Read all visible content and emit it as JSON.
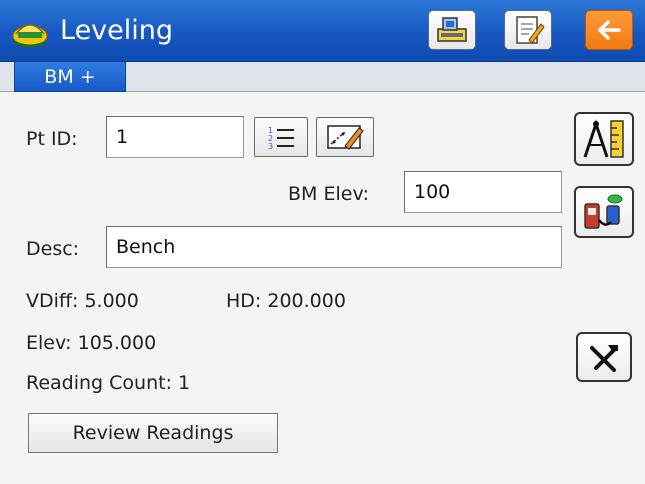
{
  "app": {
    "title": "Leveling"
  },
  "titlebar": {
    "icons": [
      "leveling-app-icon",
      "survey-instrument-icon",
      "notes-icon",
      "back-arrow-icon"
    ]
  },
  "tabs": [
    {
      "label": "BM +"
    }
  ],
  "form": {
    "pt_id_label": "Pt ID:",
    "pt_id_value": "1",
    "bm_elev_label": "BM Elev:",
    "bm_elev_value": "100",
    "desc_label": "Desc:",
    "desc_value": "Bench"
  },
  "results": {
    "vdiff": "VDiff: 5.000",
    "hd": "HD:  200.000",
    "elev": "Elev: 105.000",
    "reading_count": "Reading Count: 1"
  },
  "buttons": {
    "review_readings": "Review Readings"
  },
  "colors": {
    "titlebar": "#1757c2",
    "tab": "#1659c8",
    "back_button": "#f27a10",
    "panel": "#f4f4f2"
  }
}
